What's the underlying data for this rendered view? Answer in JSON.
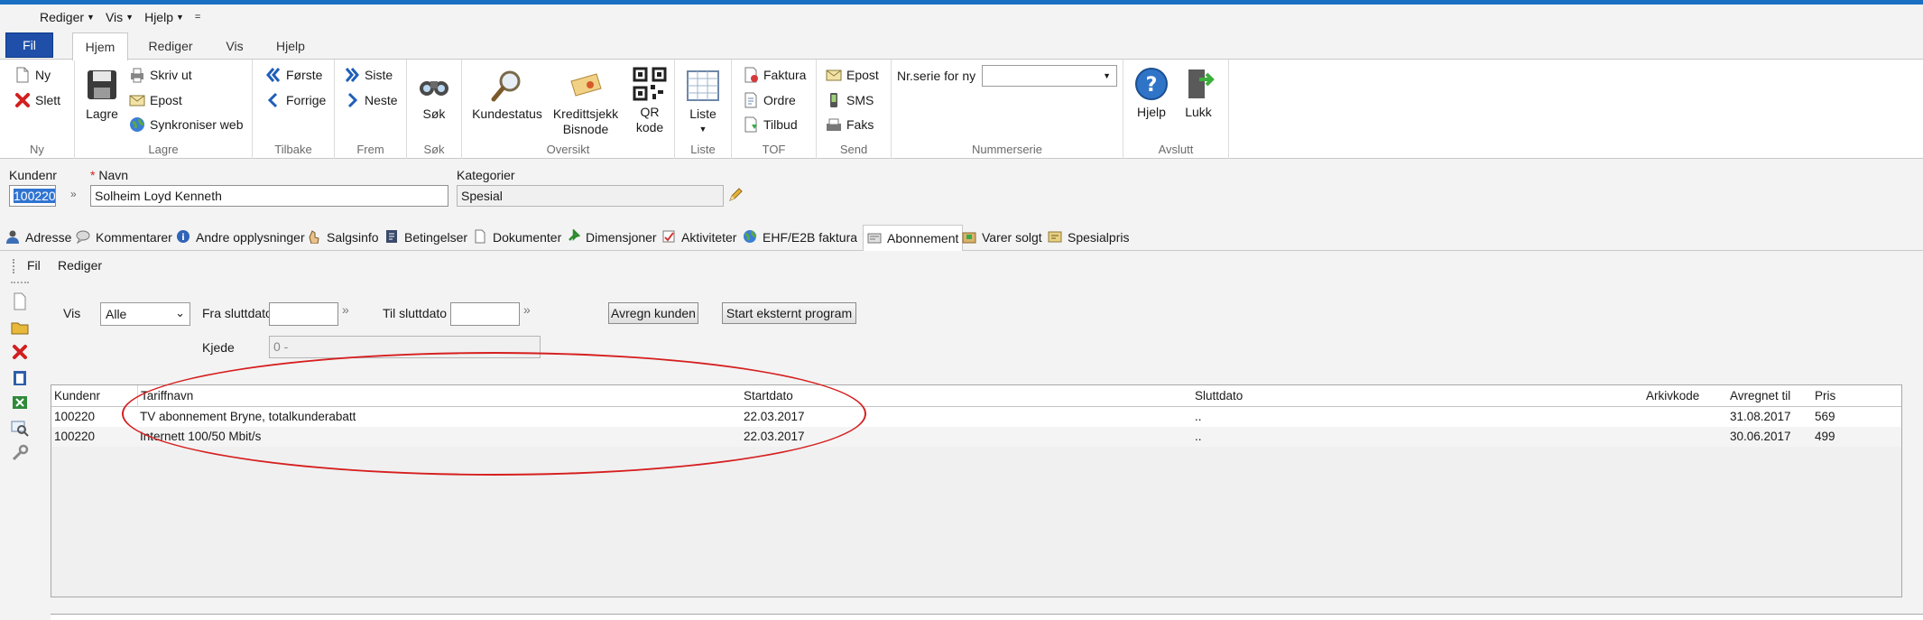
{
  "qat": {
    "rediger": "Rediger",
    "vis": "Vis",
    "hjelp": "Hjelp",
    "extra": "="
  },
  "ribbon_tabs": [
    "Fil",
    "Hjem",
    "Rediger",
    "Vis",
    "Hjelp"
  ],
  "ribbon": {
    "ny": {
      "new": "Ny",
      "delete": "Slett",
      "label": "Ny"
    },
    "lagre": {
      "save": "Lagre",
      "print": "Skriv ut",
      "email": "Epost",
      "sync": "Synkroniser web",
      "label": "Lagre"
    },
    "tilbake": {
      "first": "Første",
      "prev": "Forrige",
      "label": "Tilbake"
    },
    "frem": {
      "last": "Siste",
      "next": "Neste",
      "label": "Frem"
    },
    "sok": {
      "search": "Søk",
      "label": "Søk"
    },
    "oversikt": {
      "status": "Kundestatus",
      "credit": "Kredittsjekk\nBisnode",
      "qr": "QR\nkode",
      "label": "Oversikt"
    },
    "liste": {
      "list": "Liste",
      "label": "Liste"
    },
    "tof": {
      "invoice": "Faktura",
      "order": "Ordre",
      "offer": "Tilbud",
      "label": "TOF"
    },
    "send": {
      "email": "Epost",
      "sms": "SMS",
      "fax": "Faks",
      "label": "Send"
    },
    "nummerserie": {
      "caption": "Nr.serie for ny",
      "value": "",
      "label": "Nummerserie"
    },
    "avslutt": {
      "help": "Hjelp",
      "close": "Lukk",
      "label": "Avslutt"
    }
  },
  "customer": {
    "kundenr_label": "Kundenr",
    "kundenr_value": "100220",
    "navn_label": "Navn",
    "required_mark": "*",
    "navn_value": "Solheim Loyd Kenneth",
    "kategorier_label": "Kategorier",
    "kategorier_value": "Spesial"
  },
  "tabs": [
    "Adresse",
    "Kommentarer",
    "Andre opplysninger",
    "Salgsinfo",
    "Betingelser",
    "Dokumenter",
    "Dimensjoner",
    "Aktiviteter",
    "EHF/E2B faktura",
    "Abonnement",
    "Varer solgt",
    "Spesialpris"
  ],
  "sub_menu": {
    "fil": "Fil",
    "rediger": "Rediger"
  },
  "filters": {
    "vis_label": "Vis",
    "vis_value": "Alle",
    "fra_label": "Fra sluttdato",
    "til_label": "Til sluttdato",
    "kjede_label": "Kjede",
    "kjede_value": "0 -",
    "btn_avregn": "Avregn kunden",
    "btn_start": "Start eksternt program"
  },
  "grid": {
    "headers": [
      "Kundenr",
      "Tariffnavn",
      "Startdato",
      "Sluttdato",
      "Arkivkode",
      "Avregnet til",
      "Pris"
    ],
    "rows": [
      [
        "100220",
        "TV abonnement Bryne, totalkunderabatt",
        "22.03.2017",
        "..",
        "",
        "31.08.2017",
        "569"
      ],
      [
        "100220",
        "Internett 100/50 Mbit/s",
        "22.03.2017",
        "..",
        "",
        "30.06.2017",
        "499"
      ]
    ]
  },
  "colors": {
    "accent": "#1a6fc4",
    "fil_tab": "#1f4fa8",
    "highlight": "#d61f1f"
  }
}
